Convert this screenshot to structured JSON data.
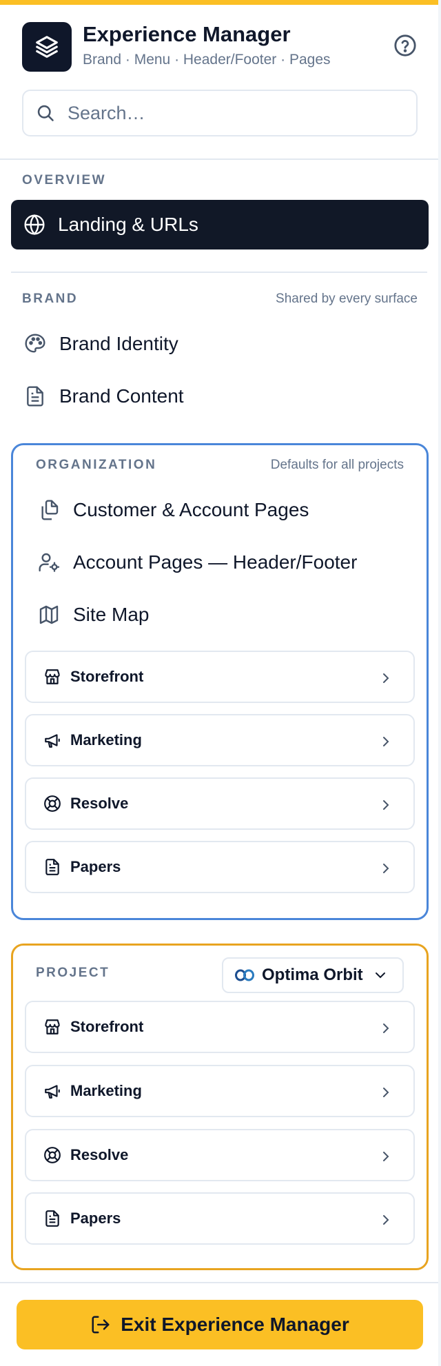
{
  "app": {
    "title": "Experience Manager",
    "subtitle": "Brand · Menu · Header/Footer · Pages",
    "help_icon": "help-circle-icon",
    "logo_icon": "layers-icon"
  },
  "search": {
    "placeholder": "Search…",
    "value": ""
  },
  "overview": {
    "label": "OVERVIEW",
    "active_item": {
      "label": "Landing & URLs",
      "icon": "globe-icon"
    }
  },
  "brand": {
    "label": "BRAND",
    "note": "Shared by every surface",
    "items": [
      {
        "label": "Brand Identity",
        "icon": "palette-icon"
      },
      {
        "label": "Brand Content",
        "icon": "file-text-icon"
      }
    ]
  },
  "organization": {
    "label": "ORGANIZATION",
    "note": "Defaults for all projects",
    "items": [
      {
        "label": "Customer & Account Pages",
        "icon": "copy-pages-icon"
      },
      {
        "label": "Account Pages — Header/Footer",
        "icon": "user-settings-icon"
      },
      {
        "label": "Site Map",
        "icon": "map-icon"
      }
    ],
    "cards": [
      {
        "label": "Storefront",
        "icon": "store-icon"
      },
      {
        "label": "Marketing",
        "icon": "megaphone-icon"
      },
      {
        "label": "Resolve",
        "icon": "lifebuoy-icon"
      },
      {
        "label": "Papers",
        "icon": "file-text-icon"
      }
    ]
  },
  "project": {
    "label": "PROJECT",
    "selected_project": "Optima Orbit",
    "cards": [
      {
        "label": "Storefront",
        "icon": "store-icon"
      },
      {
        "label": "Marketing",
        "icon": "megaphone-icon"
      },
      {
        "label": "Resolve",
        "icon": "lifebuoy-icon"
      },
      {
        "label": "Papers",
        "icon": "file-text-icon"
      }
    ]
  },
  "footer": {
    "exit_label": "Exit Experience Manager",
    "exit_icon": "log-out-icon"
  },
  "colors": {
    "accent_yellow": "#fbbf24",
    "dark": "#111827",
    "organization_border": "#4a86d9",
    "project_border": "#e8a420",
    "muted_text": "#64748b"
  }
}
